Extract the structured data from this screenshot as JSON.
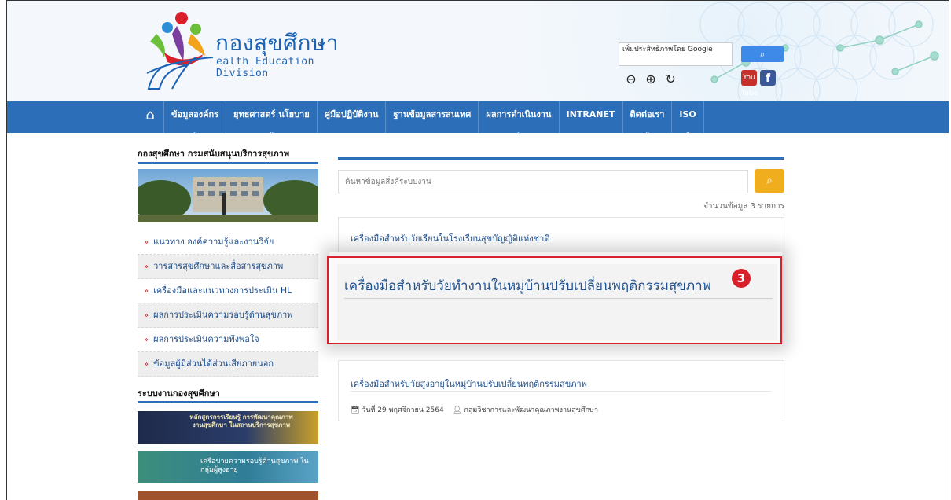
{
  "header": {
    "logo_thai": "กองสุขศึกษา",
    "logo_eng": "ealth Education Division",
    "google_label": "เพิ่มประสิทธิภาพโดย Google",
    "search_icon": "search-icon",
    "zoom_out": "⊖",
    "zoom_in": "⊕",
    "reset": "↻",
    "youtube": "You Tube",
    "facebook": "f"
  },
  "nav": {
    "home_icon": "home-icon",
    "items": [
      "ข้อมูลองค์กร",
      "ยุทธศาสตร์ นโยบาย",
      "คู่มือปฏิบัติงาน",
      "ฐานข้อมูลสารสนเทศ",
      "ผลการดำเนินงาน",
      "INTRANET",
      "ติดต่อเรา",
      "ISO"
    ]
  },
  "left": {
    "title": "กองสุขศึกษา กรมสนับสนุนบริการสุขภาพ",
    "items": [
      "แนวทาง องค์ความรู้และงานวิจัย",
      "วารสารสุขศึกษาและสื่อสารสุขภาพ",
      "เครื่องมือและแนวทางการประเมิน HL",
      "ผลการประเมินความรอบรู้ด้านสุขภาพ",
      "ผลการประเมินความพึงพอใจ",
      "ข้อมูลผู้มีส่วนได้ส่วนเสียภายนอก"
    ],
    "system_title": "ระบบงานกองสุขศึกษา",
    "banner1": "หลักสูตรการเรียนรู้ การพัฒนาคุณภาพงานสุขศึกษา ในสถานบริการสุขภาพ",
    "banner2": "เครือข่ายความรอบรู้ด้านสุขภาพ ในกลุ่มผู้สูงอายุ"
  },
  "main": {
    "search_placeholder": "ค้นหาข้อมูลสิ่งค้ระบบงาน",
    "count": "จำนวนข้อมูล 3 รายการ",
    "cards": [
      {
        "title": "เครื่องมือสำหรับวัยเรียนในโรงเรียนสุขบัญญัติแห่งชาติ"
      },
      {
        "title": "เครื่องมือสำหรับวัยทำงานในหมู่บ้านปรับเปลี่ยนพฤติกรรมสุขภาพ",
        "badge": "3"
      },
      {
        "title": "เครื่องมือสำหรับวัยสูงอายุในหมู่บ้านปรับเปลี่ยนพฤติกรรมสุขภาพ",
        "date": "วันที่ 29 พฤศจิกายน 2564",
        "org": "กลุ่มวิชาการและพัฒนาคุณภาพงานสุขศึกษา"
      }
    ]
  },
  "colors": {
    "nav": "#2c6fb8",
    "accent_red": "#d9202a",
    "search_btn": "#f0ad1e",
    "link": "#1f4f8c"
  }
}
